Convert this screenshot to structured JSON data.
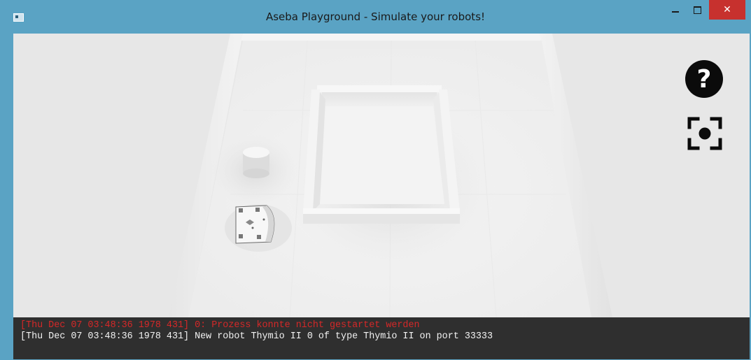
{
  "window": {
    "title": "Aseba Playground - Simulate your robots!",
    "controls": {
      "minimize_icon": "minimize-icon",
      "maximize_icon": "maximize-icon",
      "close_icon": "close-icon",
      "close_glyph": "✕",
      "close_color": "#c7312e"
    },
    "titlebar_color": "#5aa3c4"
  },
  "overlay": {
    "help_glyph": "?",
    "help_icon": "question-icon",
    "camera_icon": "camera-focus-icon"
  },
  "console": {
    "lines": [
      {
        "text": "[Thu Dec 07 03:48:36 1978 431] 0: Prozess konnte nicht gestartet werden",
        "level": "error",
        "color": "#d62828"
      },
      {
        "text": "[Thu Dec 07 03:48:36 1978 431] New robot Thymio II 0 of type Thymio II on port 33333",
        "level": "info",
        "color": "#f2f2f2"
      }
    ]
  }
}
